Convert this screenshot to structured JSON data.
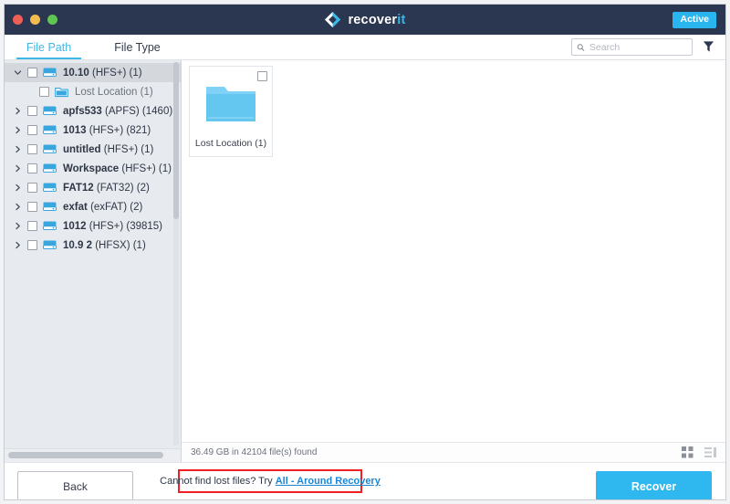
{
  "window": {
    "traffic_lights": [
      "close",
      "minimize",
      "maximize"
    ],
    "brand_name_primary": "recover",
    "brand_name_accent": "it",
    "active_badge": "Active",
    "accent_color": "#29b6ef",
    "titlebar_color": "#2b3751"
  },
  "tabs": [
    {
      "label": "File Path",
      "active": true
    },
    {
      "label": "File Type",
      "active": false
    }
  ],
  "search": {
    "placeholder": "Search",
    "value": "",
    "icon": "search-icon",
    "filter_icon": "filter-funnel-icon"
  },
  "sidebar": {
    "items": [
      {
        "name": "10.10",
        "detail": "(HFS+) (1)",
        "expanded": true,
        "selected": true,
        "indent": 0,
        "icon": "drive-icon",
        "checked": false
      },
      {
        "name": "Lost Location",
        "detail": "(1)",
        "expanded": false,
        "selected": false,
        "indent": 1,
        "icon": "folder-icon",
        "checked": false
      },
      {
        "name": "apfs533",
        "detail": "(APFS) (1460)",
        "expanded": false,
        "selected": false,
        "indent": 0,
        "icon": "drive-icon",
        "checked": false
      },
      {
        "name": "1013",
        "detail": "(HFS+) (821)",
        "expanded": false,
        "selected": false,
        "indent": 0,
        "icon": "drive-icon",
        "checked": false
      },
      {
        "name": "untitled",
        "detail": "(HFS+) (1)",
        "expanded": false,
        "selected": false,
        "indent": 0,
        "icon": "drive-icon",
        "checked": false
      },
      {
        "name": "Workspace",
        "detail": "(HFS+) (1)",
        "expanded": false,
        "selected": false,
        "indent": 0,
        "icon": "drive-icon",
        "checked": false
      },
      {
        "name": "FAT12",
        "detail": "(FAT32) (2)",
        "expanded": false,
        "selected": false,
        "indent": 0,
        "icon": "drive-icon",
        "checked": false
      },
      {
        "name": "exfat",
        "detail": "(exFAT) (2)",
        "expanded": false,
        "selected": false,
        "indent": 0,
        "icon": "drive-icon",
        "checked": false
      },
      {
        "name": "1012",
        "detail": "(HFS+) (39815)",
        "expanded": false,
        "selected": false,
        "indent": 0,
        "icon": "drive-icon",
        "checked": false
      },
      {
        "name": "10.9 2",
        "detail": "(HFSX) (1)",
        "expanded": false,
        "selected": false,
        "indent": 0,
        "icon": "drive-icon",
        "checked": false
      }
    ]
  },
  "content": {
    "files": [
      {
        "label": "Lost Location (1)",
        "icon": "folder-icon",
        "checked": false
      }
    ]
  },
  "statusbar": {
    "text": "36.49 GB in 42104 file(s) found",
    "view_grid_icon": "grid-view-icon",
    "view_list_icon": "list-view-icon"
  },
  "footer": {
    "back_label": "Back",
    "hint_prefix": "Cannot find lost files? Try ",
    "hint_link": "All - Around Recovery",
    "hint_border_color": "#ed2024",
    "recover_label": "Recover",
    "recover_color": "#2fb8ef"
  }
}
